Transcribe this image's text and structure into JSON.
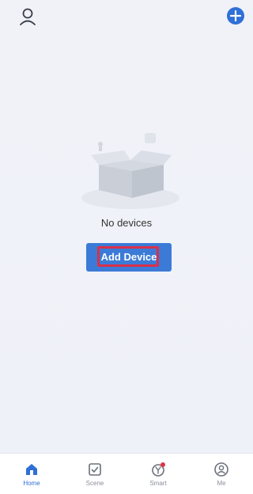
{
  "header": {
    "profile_icon": "user-icon",
    "add_icon": "plus-icon",
    "accent_color": "#2f6fd6"
  },
  "empty_state": {
    "message": "No devices",
    "illustration_icon": "empty-box-icon",
    "button_label": "Add Device"
  },
  "bottom_nav": {
    "items": [
      {
        "label": "Home",
        "icon": "home-icon",
        "active": true
      },
      {
        "label": "Scene",
        "icon": "checkbox-icon",
        "active": false
      },
      {
        "label": "Smart",
        "icon": "smart-icon",
        "active": false,
        "badge": true
      },
      {
        "label": "Me",
        "icon": "profile-circle-icon",
        "active": false
      }
    ]
  }
}
